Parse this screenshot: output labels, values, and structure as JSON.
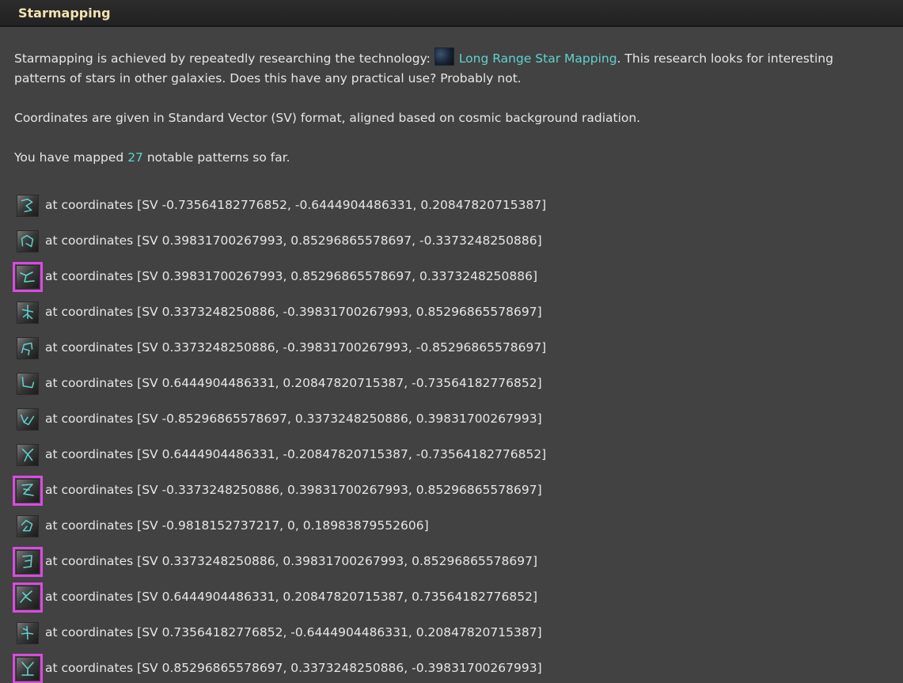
{
  "header": {
    "title": "Starmapping"
  },
  "intro": {
    "prefix": "Starmapping is achieved by repeatedly researching the technology: ",
    "tech_link": "Long Range Star Mapping",
    "suffix": ". This research looks for interesting patterns of stars in other galaxies. Does this have any practical use? Probably not."
  },
  "coords_note": "Coordinates are given in Standard Vector (SV) format, aligned based on cosmic background radiation.",
  "mapped": {
    "prefix": "You have mapped ",
    "count": "27",
    "suffix": " notable patterns so far."
  },
  "accent": "#5fd3cf",
  "highlight": "#d94be0",
  "patterns": [
    {
      "text": "at coordinates [SV -0.73564182776852, -0.6444904486331, 0.20847820715387]",
      "highlight": false,
      "icon": "constellation-icon"
    },
    {
      "text": "at coordinates [SV 0.39831700267993, 0.85296865578697, -0.3373248250886]",
      "highlight": false,
      "icon": "constellation-icon"
    },
    {
      "text": "at coordinates [SV 0.39831700267993, 0.85296865578697, 0.3373248250886]",
      "highlight": true,
      "icon": "constellation-icon"
    },
    {
      "text": "at coordinates [SV 0.3373248250886, -0.39831700267993, 0.85296865578697]",
      "highlight": false,
      "icon": "constellation-icon"
    },
    {
      "text": "at coordinates [SV 0.3373248250886, -0.39831700267993, -0.85296865578697]",
      "highlight": false,
      "icon": "constellation-icon"
    },
    {
      "text": "at coordinates [SV 0.6444904486331, 0.20847820715387, -0.73564182776852]",
      "highlight": false,
      "icon": "constellation-icon"
    },
    {
      "text": "at coordinates [SV -0.85296865578697, 0.3373248250886, 0.39831700267993]",
      "highlight": false,
      "icon": "constellation-icon"
    },
    {
      "text": "at coordinates [SV 0.6444904486331, -0.20847820715387, -0.73564182776852]",
      "highlight": false,
      "icon": "constellation-icon"
    },
    {
      "text": "at coordinates [SV -0.3373248250886, 0.39831700267993, 0.85296865578697]",
      "highlight": true,
      "icon": "constellation-icon"
    },
    {
      "text": "at coordinates [SV -0.9818152737217, 0, 0.18983879552606]",
      "highlight": false,
      "icon": "constellation-icon"
    },
    {
      "text": "at coordinates [SV 0.3373248250886, 0.39831700267993, 0.85296865578697]",
      "highlight": true,
      "icon": "constellation-icon"
    },
    {
      "text": "at coordinates [SV 0.6444904486331, 0.20847820715387, 0.73564182776852]",
      "highlight": true,
      "icon": "constellation-icon"
    },
    {
      "text": "at coordinates [SV 0.73564182776852, -0.6444904486331, 0.20847820715387]",
      "highlight": false,
      "icon": "constellation-icon"
    },
    {
      "text": "at coordinates [SV 0.85296865578697, 0.3373248250886, -0.39831700267993]",
      "highlight": true,
      "icon": "constellation-icon"
    }
  ]
}
